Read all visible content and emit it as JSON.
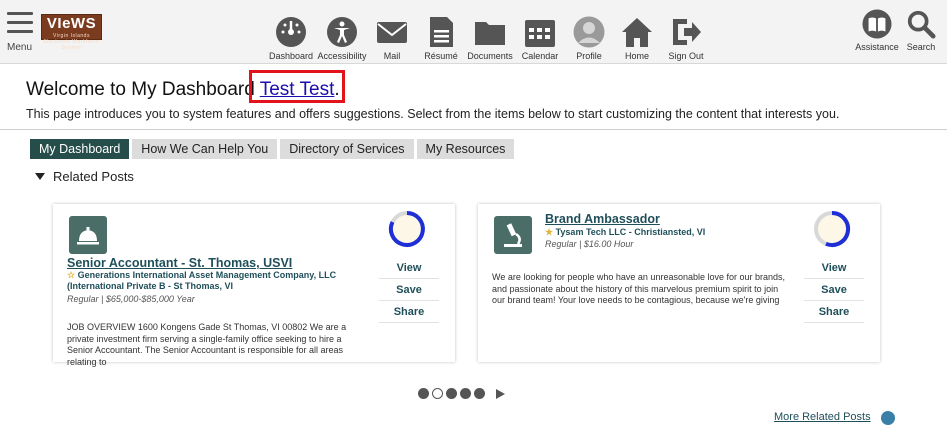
{
  "header": {
    "menu_label": "Menu",
    "logo_text": "VIeWS",
    "logo_subtext": "Virgin Islands Electronic Workforce System",
    "nav": [
      {
        "label": "Dashboard",
        "icon": "dashboard-icon"
      },
      {
        "label": "Accessibility",
        "icon": "accessibility-icon"
      },
      {
        "label": "Mail",
        "icon": "mail-icon"
      },
      {
        "label": "Résumé",
        "icon": "resume-icon"
      },
      {
        "label": "Documents",
        "icon": "documents-icon"
      },
      {
        "label": "Calendar",
        "icon": "calendar-icon"
      },
      {
        "label": "Profile",
        "icon": "profile-icon"
      },
      {
        "label": "Home",
        "icon": "home-icon"
      },
      {
        "label": "Sign Out",
        "icon": "sign-out-icon"
      }
    ],
    "right": [
      {
        "label": "Assistance",
        "icon": "book-icon"
      },
      {
        "label": "Search",
        "icon": "search-icon"
      }
    ]
  },
  "welcome": {
    "prefix": "Welcome to My Dashboard ",
    "name": "Test Test",
    "suffix": ".",
    "intro": "This page introduces you to system features and offers suggestions. Select from the items below to start customizing the content that interests you."
  },
  "tabs": [
    {
      "label": "My Dashboard",
      "active": true
    },
    {
      "label": "How We Can Help You",
      "active": false
    },
    {
      "label": "Directory of Services",
      "active": false
    },
    {
      "label": "My Resources",
      "active": false
    }
  ],
  "related_posts": {
    "heading": "Related Posts",
    "more_label": "More Related Posts"
  },
  "cards": [
    {
      "icon": "bell-icon",
      "title": "Senior Accountant - St. Thomas, USVI",
      "company": "Generations International Asset Management Company, LLC (International Private B - St Thomas, VI",
      "meta": "Regular | $65,000-$85,000 Year",
      "description": "JOB OVERVIEW 1600 Kongens Gade St Thomas, VI 00802 We are a private investment firm serving a single-family office seeking to hire a Senior Accountant. The Senior Accountant is responsible for all areas relating to",
      "actions": [
        "View",
        "Save",
        "Share"
      ]
    },
    {
      "icon": "microscope-icon",
      "title": "Brand Ambassador",
      "company": "Tysam Tech LLC - Christiansted, VI",
      "meta": "Regular | $16.00 Hour",
      "description": "We are looking for people who have an unreasonable love for our brands, and passionate about the history of this marvelous premium spirit to join our brand team! Your love needs to be contagious, because we're giving",
      "actions": [
        "View",
        "Save",
        "Share"
      ]
    }
  ],
  "pager": {
    "pages": 5,
    "current": 2
  },
  "colors": {
    "accent_dark": "#254d4a",
    "link": "#1a0dab",
    "title_teal": "#1f4f5a",
    "highlight_red": "#e3131b",
    "ring_blue": "#1f2fd6"
  }
}
